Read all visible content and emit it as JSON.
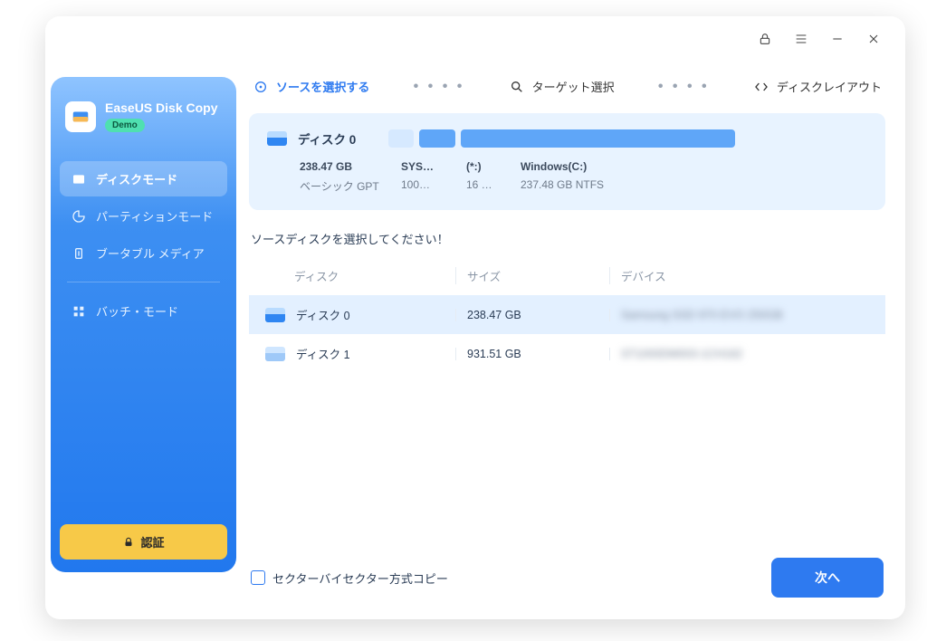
{
  "brand": {
    "name": "EaseUS Disk Copy",
    "badge": "Demo"
  },
  "sidebar": {
    "items": [
      {
        "label": "ディスクモード"
      },
      {
        "label": "パーティションモード"
      },
      {
        "label": "ブータブル メディア"
      },
      {
        "label": "バッチ・モード"
      }
    ],
    "activate": "認証"
  },
  "steps": [
    {
      "label": "ソースを選択する"
    },
    {
      "label": "ターゲット選択"
    },
    {
      "label": "ディスクレイアウト"
    }
  ],
  "dots": "• • • •",
  "selected_disk": {
    "name": "ディスク 0",
    "cols": [
      {
        "l1": "238.47 GB",
        "l2": "ベーシック GPT"
      },
      {
        "l1": "SYS…",
        "l2": "100…"
      },
      {
        "l1": "(*:)",
        "l2": "16 …"
      },
      {
        "l1": "Windows(C:)",
        "l2": "237.48 GB NTFS"
      }
    ]
  },
  "prompt": "ソースディスクを選択してください！",
  "table": {
    "headers": {
      "name": "ディスク",
      "size": "サイズ",
      "device": "デバイス"
    },
    "rows": [
      {
        "name": "ディスク 0",
        "size": "238.47 GB",
        "device": "Samsung SSD 970 EVO 250GB",
        "selected": true
      },
      {
        "name": "ディスク 1",
        "size": "931.51 GB",
        "device": "ST1000DM003-1CH162",
        "selected": false
      }
    ]
  },
  "checkbox_label": "セクターバイセクター方式コピー",
  "next": "次へ"
}
